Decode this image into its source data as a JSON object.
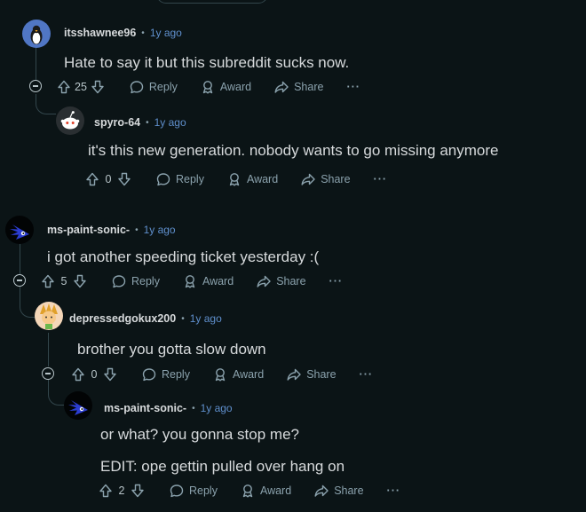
{
  "comments": [
    {
      "user": "itsshawnee96",
      "sep": "•",
      "time": "1y ago",
      "text": "Hate to say it but this subreddit sucks now.",
      "score": "25",
      "reply": "Reply",
      "award": "Award",
      "share": "Share",
      "more": "···"
    },
    {
      "user": "spyro-64",
      "sep": "•",
      "time": "1y ago",
      "text": "it's this new generation. nobody wants to go missing anymore",
      "score": "0",
      "reply": "Reply",
      "award": "Award",
      "share": "Share",
      "more": "···"
    },
    {
      "user": "ms-paint-sonic-",
      "sep": "•",
      "time": "1y ago",
      "text": "i got another speeding ticket yesterday :(",
      "score": "5",
      "reply": "Reply",
      "award": "Award",
      "share": "Share",
      "more": "···"
    },
    {
      "user": "depressedgokux200",
      "sep": "•",
      "time": "1y ago",
      "text": "brother you gotta slow down",
      "score": "0",
      "reply": "Reply",
      "award": "Award",
      "share": "Share",
      "more": "···"
    },
    {
      "user": "ms-paint-sonic-",
      "sep": "•",
      "time": "1y ago",
      "text": "or what? you gonna stop me?",
      "text2": "EDIT: ope gettin pulled over hang on",
      "score": "2",
      "reply": "Reply",
      "award": "Award",
      "share": "Share",
      "more": "···"
    }
  ],
  "icons": {
    "upvote": "upvote-arrow-icon",
    "downvote": "downvote-arrow-icon",
    "reply": "speech-bubble-icon",
    "award": "award-ribbon-icon",
    "share": "share-arrow-icon",
    "more": "ellipsis-icon",
    "collapse": "collapse-minus-icon"
  },
  "colors": {
    "background": "#0b1416",
    "text": "#d7dadc",
    "muted": "#8ba2ad",
    "timestamp": "#5f8fcc",
    "thread": "#33464c"
  }
}
